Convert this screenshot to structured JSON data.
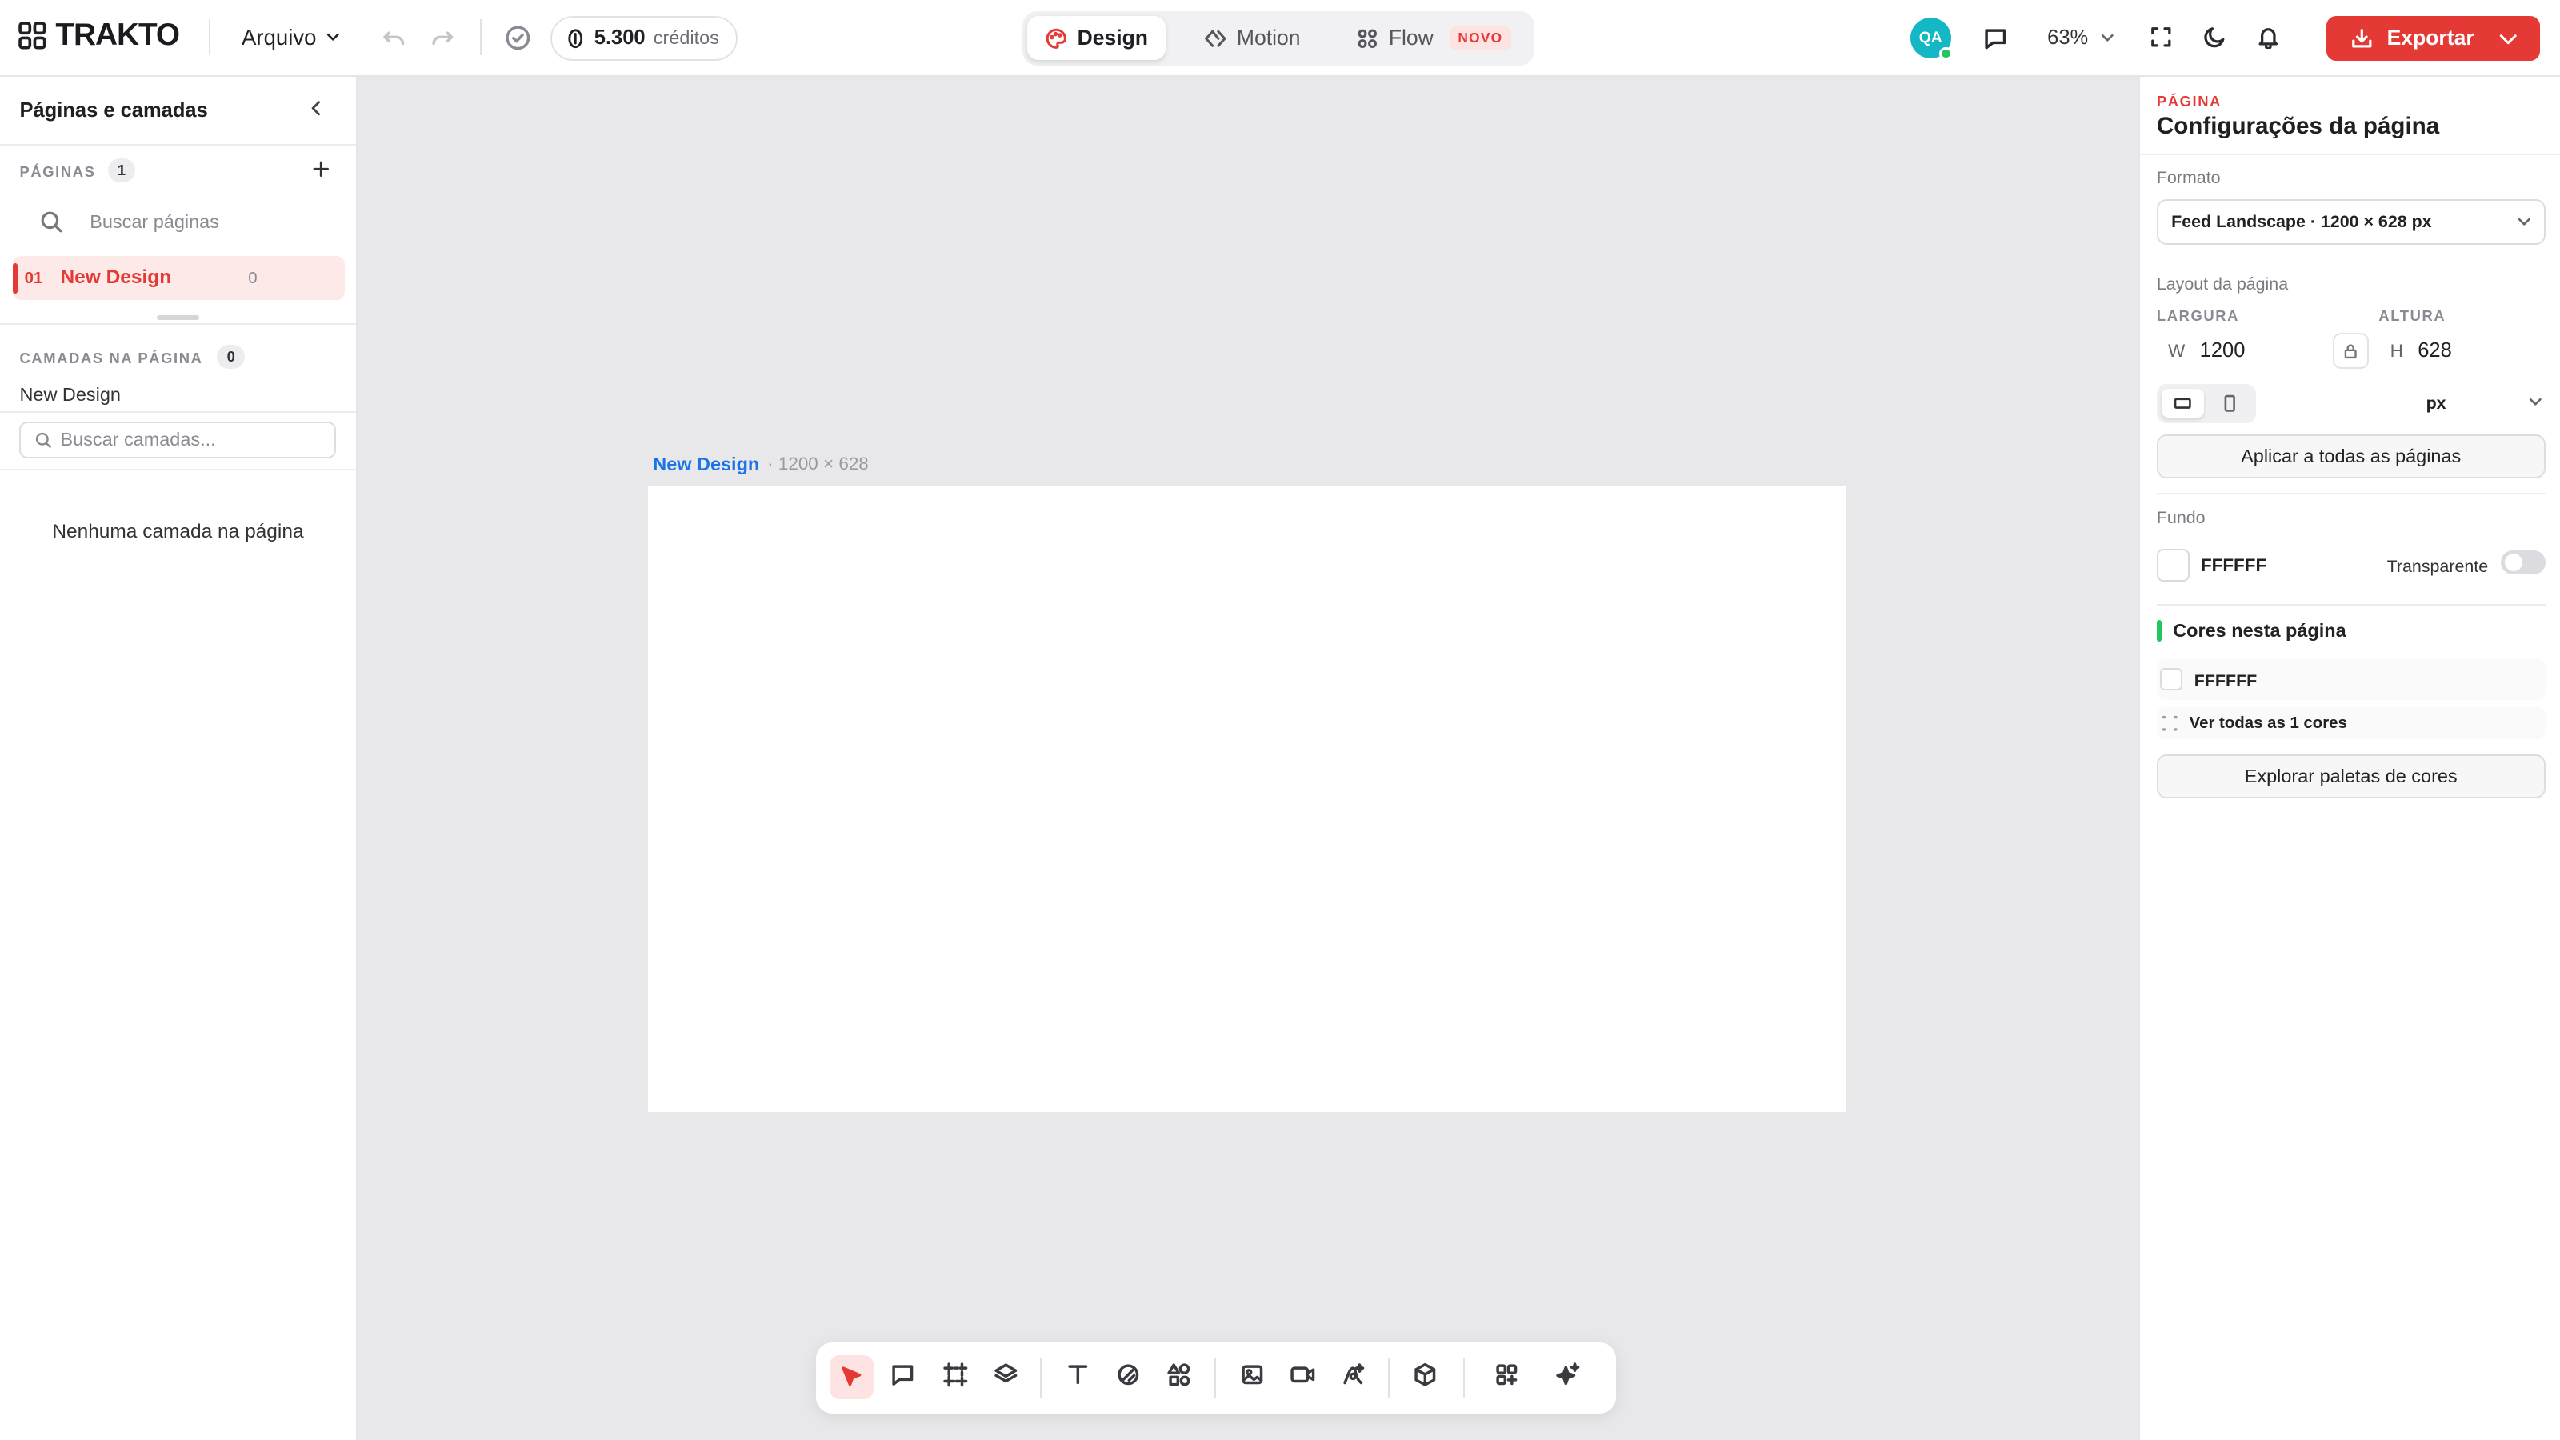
{
  "app": {
    "logo_text": "TRAKTO",
    "brand_color": "#e53935",
    "accent_blue": "#1a73e8"
  },
  "topbar": {
    "file_menu": "Arquivo",
    "credits_value": "5.300",
    "credits_label": "créditos",
    "modes": [
      {
        "label": "Design",
        "active": true
      },
      {
        "label": "Motion",
        "active": false
      },
      {
        "label": "Flow",
        "active": false,
        "badge": "NOVO"
      }
    ],
    "avatar_initials": "QA",
    "zoom": "63%",
    "export_label": "Exportar"
  },
  "left_panel": {
    "title": "Páginas e camadas",
    "pages_label": "PÁGINAS",
    "pages_count": "1",
    "search_pages_placeholder": "Buscar páginas",
    "pages": [
      {
        "number": "01",
        "name": "New Design",
        "count": "0"
      }
    ],
    "layers_label": "CAMADAS NA PÁGINA",
    "layers_count": "0",
    "current_page_name": "New Design",
    "search_layers_placeholder": "Buscar camadas...",
    "empty_text": "Nenhuma camada na página"
  },
  "canvas": {
    "page_name": "New Design",
    "page_size": "· 1200 × 628",
    "background": "#FFFFFF"
  },
  "right_panel": {
    "section_tag": "PÁGINA",
    "title": "Configurações da página",
    "format_label": "Formato",
    "format_value": "Feed Landscape · 1200 × 628 px",
    "layout_label": "Layout da página",
    "width_label": "LARGURA",
    "height_label": "ALTURA",
    "w_prefix": "W",
    "h_prefix": "H",
    "width_value": "1200",
    "height_value": "628",
    "unit": "px",
    "apply_all_label": "Aplicar a todas as páginas",
    "background_label": "Fundo",
    "background_value": "FFFFFF",
    "transparent_label": "Transparente",
    "colors_title": "Cores nesta página",
    "colors": [
      "FFFFFF"
    ],
    "see_all_colors": "Ver todas as 1 cores",
    "explore_palettes": "Explorar paletas de cores"
  }
}
